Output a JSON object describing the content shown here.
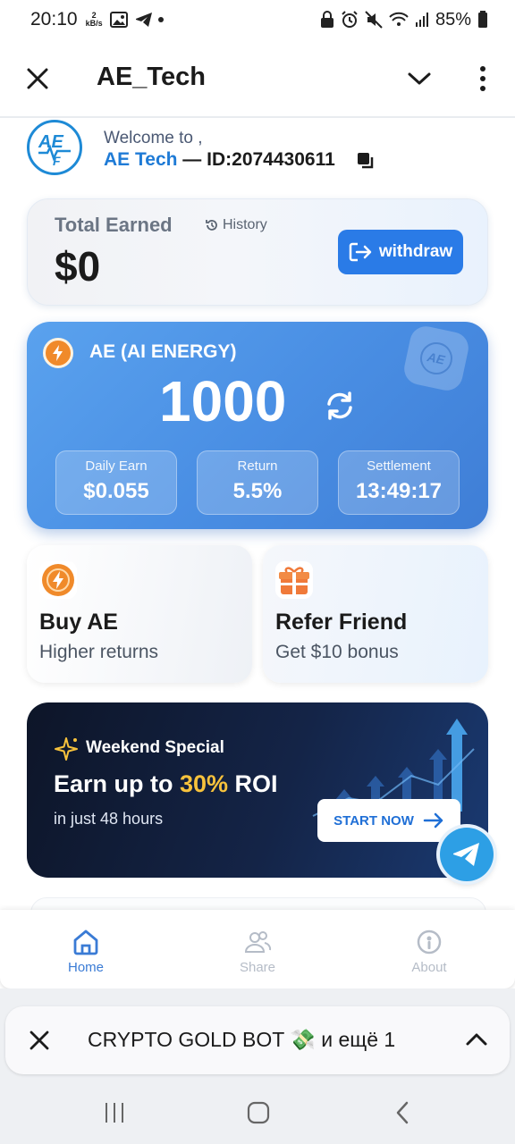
{
  "status_bar": {
    "time": "20:10",
    "net_speed_value": "2",
    "net_speed_unit": "kB/s",
    "battery": "85%"
  },
  "app_bar": {
    "title": "AE_Tech"
  },
  "welcome": {
    "greeting": "Welcome to ,",
    "brand": "AE Tech",
    "separator": " — ",
    "user_id": "ID:2074430611"
  },
  "earned": {
    "label": "Total Earned",
    "history_label": "History",
    "amount": "$0",
    "withdraw_label": "withdraw"
  },
  "energy": {
    "title": "AE (AI ENERGY)",
    "value": "1000",
    "stats": [
      {
        "label": "Daily Earn",
        "value": "$0.055"
      },
      {
        "label": "Return",
        "value": "5.5%"
      },
      {
        "label": "Settlement",
        "value": "13:49:17"
      }
    ]
  },
  "actions": {
    "buy": {
      "title": "Buy AE",
      "subtitle": "Higher returns"
    },
    "refer": {
      "title": "Refer Friend",
      "subtitle": "Get $10 bonus"
    }
  },
  "promo": {
    "tag": "Weekend Special",
    "headline_pre": "Earn up to ",
    "headline_highlight": "30%",
    "headline_post": " ROI",
    "subtitle": "in just 48 hours",
    "cta": "START NOW",
    "highlight_color": "#f7c23c"
  },
  "bottom_nav": {
    "items": [
      {
        "label": "Home",
        "icon": "home-icon",
        "active": true
      },
      {
        "label": "Share",
        "icon": "users-icon",
        "active": false
      },
      {
        "label": "About",
        "icon": "info-icon",
        "active": false
      }
    ]
  },
  "mini_app_bar": {
    "title": "CRYPTO GOLD BOT 💸 и ещё 1"
  },
  "colors": {
    "primary": "#2a7be7",
    "energy_card": "#4a8fe4",
    "promo_bg": "#0d1528",
    "telegram": "#2d9fe5"
  }
}
